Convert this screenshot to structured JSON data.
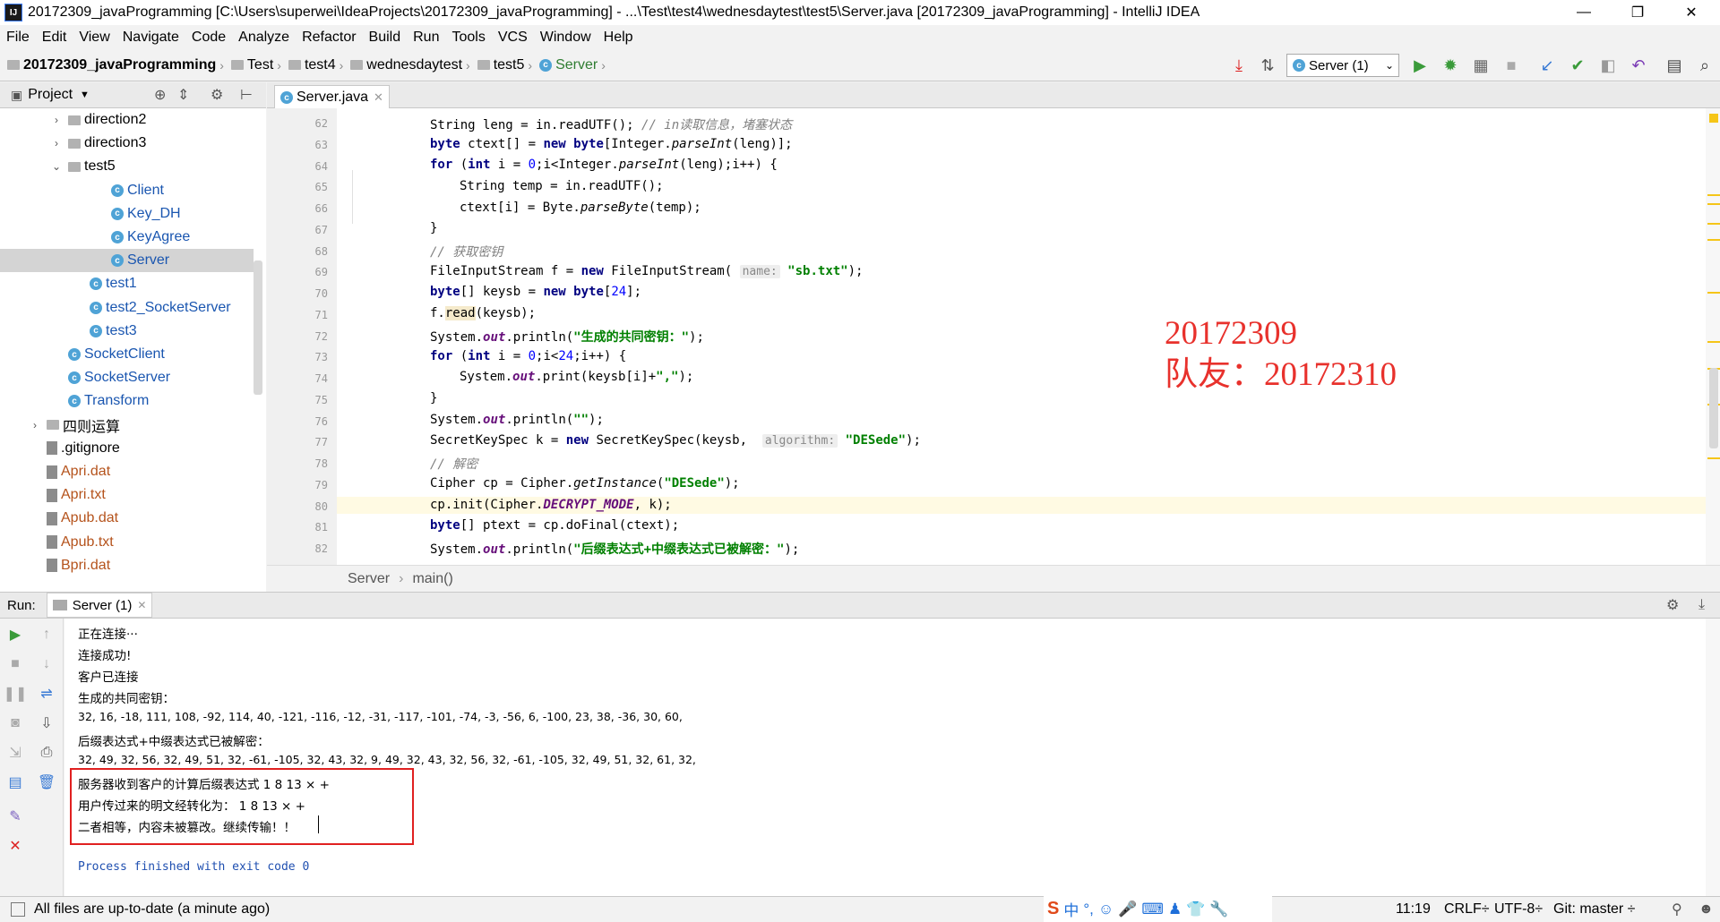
{
  "window": {
    "title": "20172309_javaProgramming [C:\\Users\\superwei\\IdeaProjects\\20172309_javaProgramming] - ...\\Test\\test4\\wednesdaytest\\test5\\Server.java [20172309_javaProgramming] - IntelliJ IDEA",
    "logo": "IJ",
    "minimize": "—",
    "restore": "❐",
    "close": "✕"
  },
  "menu": [
    "File",
    "Edit",
    "View",
    "Navigate",
    "Code",
    "Analyze",
    "Refactor",
    "Build",
    "Run",
    "Tools",
    "VCS",
    "Window",
    "Help"
  ],
  "breadcrumbs": [
    "20172309_javaProgramming",
    "Test",
    "test4",
    "wednesdaytest",
    "test5",
    "Server"
  ],
  "run_config": "Server (1)",
  "project_panel": {
    "label": "Project",
    "items": [
      {
        "label": "direction2",
        "type": "folder",
        "indent": 1,
        "arrow": "›"
      },
      {
        "label": "direction3",
        "type": "folder",
        "indent": 1,
        "arrow": "›"
      },
      {
        "label": "test5",
        "type": "folder",
        "indent": 1,
        "arrow": "⌄"
      },
      {
        "label": "Client",
        "type": "class",
        "indent": 3
      },
      {
        "label": "Key_DH",
        "type": "class",
        "indent": 3
      },
      {
        "label": "KeyAgree",
        "type": "class",
        "indent": 3
      },
      {
        "label": "Server",
        "type": "class",
        "indent": 3,
        "selected": true
      },
      {
        "label": "test1",
        "type": "class",
        "indent": 2
      },
      {
        "label": "test2_SocketServer",
        "type": "class",
        "indent": 2
      },
      {
        "label": "test3",
        "type": "class",
        "indent": 2
      },
      {
        "label": "SocketClient",
        "type": "class",
        "indent": 1
      },
      {
        "label": "SocketServer",
        "type": "class",
        "indent": 1
      },
      {
        "label": "Transform",
        "type": "class",
        "indent": 1
      },
      {
        "label": "四则运算",
        "type": "folder",
        "indent": 0,
        "arrow": "›"
      },
      {
        "label": ".gitignore",
        "type": "file",
        "indent": 0
      },
      {
        "label": "Apri.dat",
        "type": "dat",
        "indent": 0
      },
      {
        "label": "Apri.txt",
        "type": "dat",
        "indent": 0
      },
      {
        "label": "Apub.dat",
        "type": "dat",
        "indent": 0
      },
      {
        "label": "Apub.txt",
        "type": "dat",
        "indent": 0
      },
      {
        "label": "Bpri.dat",
        "type": "dat",
        "indent": 0
      }
    ]
  },
  "editor": {
    "tab": "Server.java",
    "line_numbers": [
      "62",
      "63",
      "64",
      "65",
      "66",
      "67",
      "68",
      "69",
      "70",
      "71",
      "72",
      "73",
      "74",
      "75",
      "76",
      "77",
      "78",
      "79",
      "80",
      "81",
      "82"
    ],
    "breadcrumb": [
      "Server",
      "main()"
    ]
  },
  "annotation": {
    "line1": "20172309",
    "line2": "队友：20172310"
  },
  "run": {
    "label": "Run:",
    "tab": "Server (1)",
    "console": [
      "正在连接···",
      "连接成功!",
      "客户已连接",
      "生成的共同密钥：",
      "32, 16, -18, 111, 108, -92, 114, 40, -121, -116, -12, -31, -117, -101, -74, -3, -56, 6, -100, 23, 38, -36, 30, 60,",
      "后缀表达式+中缀表达式已被解密：",
      "32, 49, 32, 56, 32, 49, 51, 32, -61, -105, 32, 43, 32, 9, 49, 32, 43, 32, 56, 32, -61, -105, 32, 49, 51, 32, 61, 32,",
      "服务器收到客户的计算后缀表达式 1 8 13 × +",
      "用户传过来的明文经转化为： 1 8 13 × +",
      "二者相等，内容未被篡改。继续传输！！"
    ],
    "exit": "Process finished with exit code 0"
  },
  "status": {
    "message": "All files are up-to-date (a minute ago)",
    "position": "11:19",
    "line_sep": "CRLF÷",
    "encoding": "UTF-8÷",
    "git": "Git: master ÷",
    "ime": "中"
  }
}
